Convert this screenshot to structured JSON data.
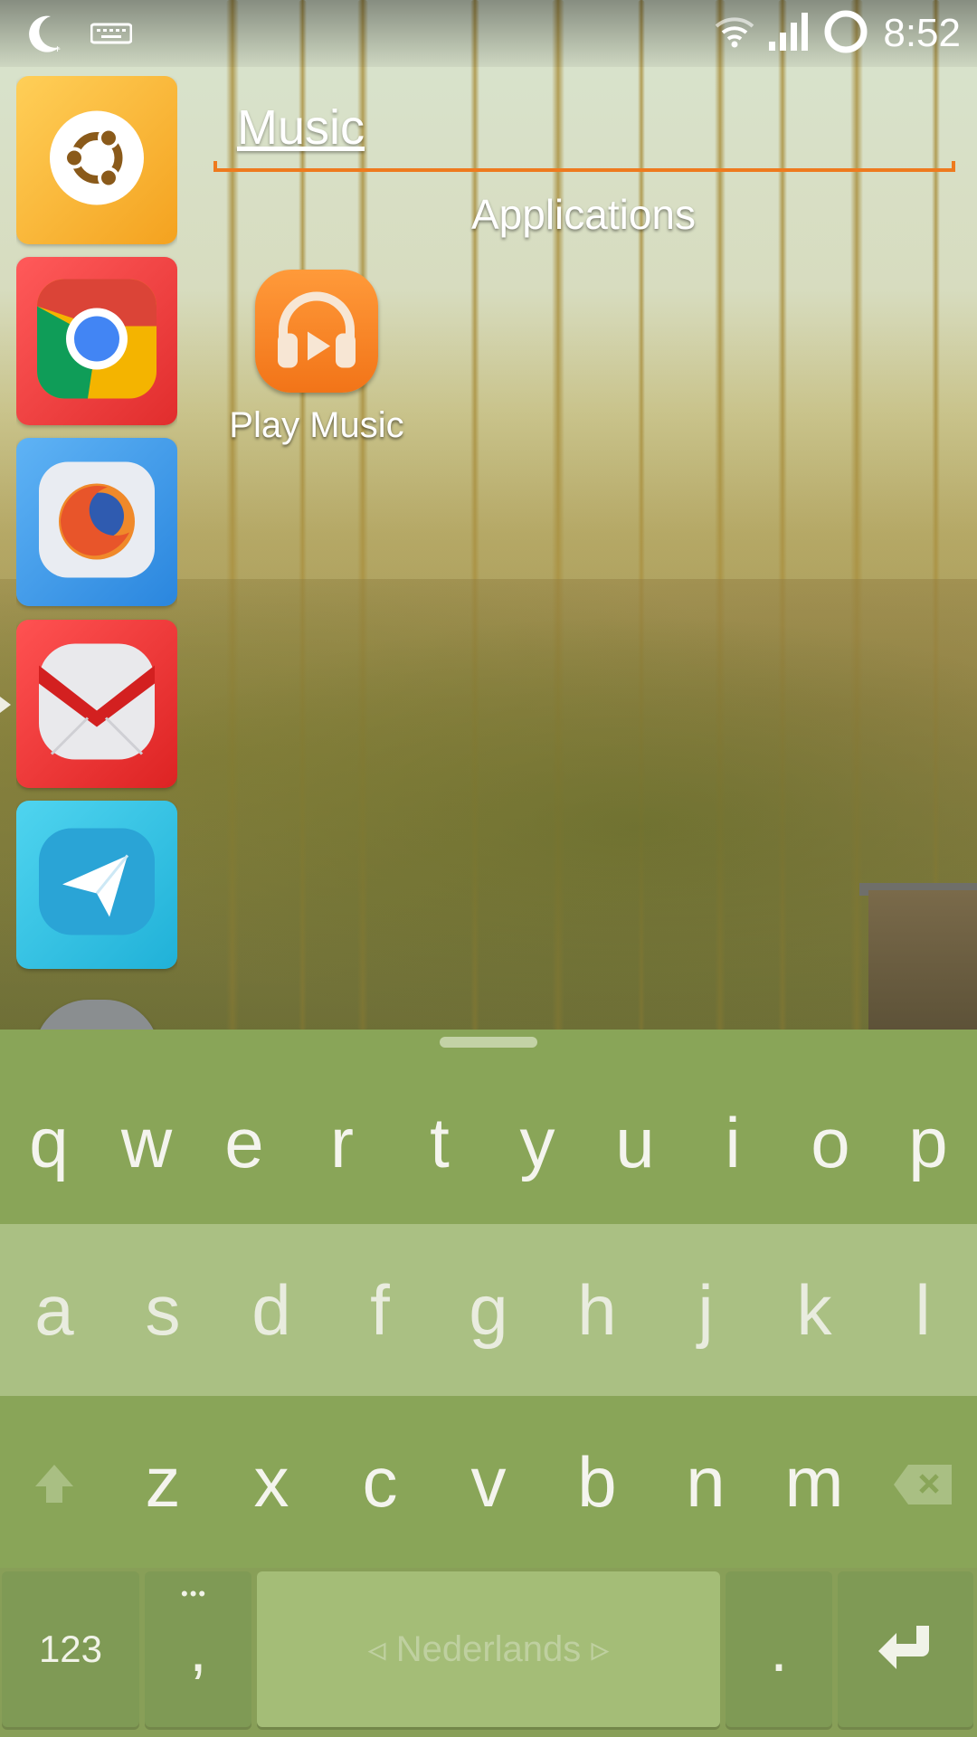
{
  "status_bar": {
    "time": "8:52",
    "icons": [
      "moon-icon",
      "keyboard-icon",
      "wifi-icon",
      "signal-icon",
      "battery-ring-icon"
    ]
  },
  "launcher": {
    "apps": [
      {
        "name": "Ubuntu",
        "icon": "ubuntu-logo-icon"
      },
      {
        "name": "Chrome",
        "icon": "chrome-icon"
      },
      {
        "name": "Firefox",
        "icon": "firefox-icon"
      },
      {
        "name": "Mail",
        "icon": "mail-envelope-icon"
      },
      {
        "name": "Telegram",
        "icon": "telegram-plane-icon"
      }
    ]
  },
  "search": {
    "query": "Music"
  },
  "results": {
    "section_title": "Applications",
    "items": [
      {
        "label": "Play Music",
        "icon": "headphones-icon"
      }
    ]
  },
  "keyboard": {
    "row1": [
      "q",
      "w",
      "e",
      "r",
      "t",
      "y",
      "u",
      "i",
      "o",
      "p"
    ],
    "row2": [
      "a",
      "s",
      "d",
      "f",
      "g",
      "h",
      "j",
      "k",
      "l"
    ],
    "row3": [
      "z",
      "x",
      "c",
      "v",
      "b",
      "n",
      "m"
    ],
    "numbers_key": "123",
    "comma_key": ",",
    "space_label": "◃ Nederlands ▹",
    "period_key": ".",
    "icons": [
      "shift-arrow-icon",
      "backspace-icon",
      "enter-icon"
    ]
  },
  "colors": {
    "keyboard_bg": "#889f58",
    "keyboard_row_light": "#aac083",
    "accent_orange": "#ee7a1e"
  }
}
